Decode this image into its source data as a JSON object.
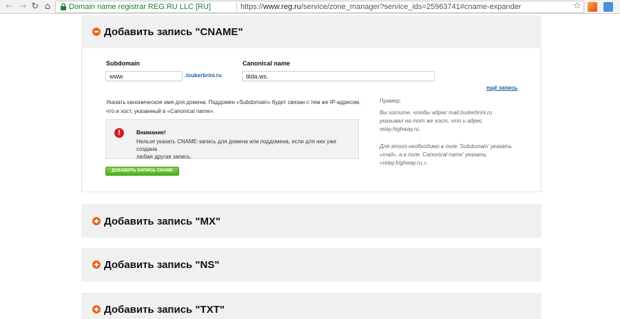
{
  "browser": {
    "site_name": "Domain name registrar REG.RU LLC [RU]",
    "url_scheme": "https://",
    "url_host": "www.reg.ru",
    "url_path": "/service/zone_manager?service_ids=25963741#cname-expander",
    "back_icon": "arrow-left-icon",
    "forward_icon": "arrow-right-icon",
    "reload_icon": "reload-icon",
    "home_icon": "home-icon",
    "lock_icon": "lock-icon",
    "star_icon": "star-icon"
  },
  "cname": {
    "title": "Добавить запись \"CNAME\"",
    "subdomain_label": "Subdomain",
    "subdomain_value": "www",
    "domain_suffix": ".tsukerbrini.ru",
    "canonical_label": "Canonical name",
    "canonical_value": "tilda.ws.",
    "more_link": "ещё запись",
    "help_line1": "Указать каноническое имя для домена. Поддомен «Subdomain» будет связан с тем же IP-адресом,",
    "help_line2": "что и хост, указанный в «Canonical name».",
    "warning_title": "Внимание!",
    "warning_line1": "Нельзя указать CNAME-запись для домена или поддомена, если для них уже создана",
    "warning_line2": "любая другая запись.",
    "add_button": "ДОБАВИТЬ ЗАПИСЬ CNAME",
    "example_title": "Пример:",
    "example_line1": "Вы хотите, чтобы адрес mail.tsukerbrini.ru",
    "example_line2": "указывал на тот же хост, что и адрес",
    "example_line3": "relay.highway.ru.",
    "example_line4": "Для этого необходимо в поле 'Subdomain' указать",
    "example_line5": "«mail», а в поле 'Canonical name' указать",
    "example_line6": "«relay.highway.ru.»."
  },
  "sections": [
    {
      "title": "Добавить запись \"MX\""
    },
    {
      "title": "Добавить запись \"NS\""
    },
    {
      "title": "Добавить запись \"TXT\""
    }
  ],
  "colors": {
    "accent_orange": "#e9661a",
    "link_blue": "#1b5e9e",
    "button_green": "#4fae1e",
    "warning_red": "#d41d1d"
  }
}
